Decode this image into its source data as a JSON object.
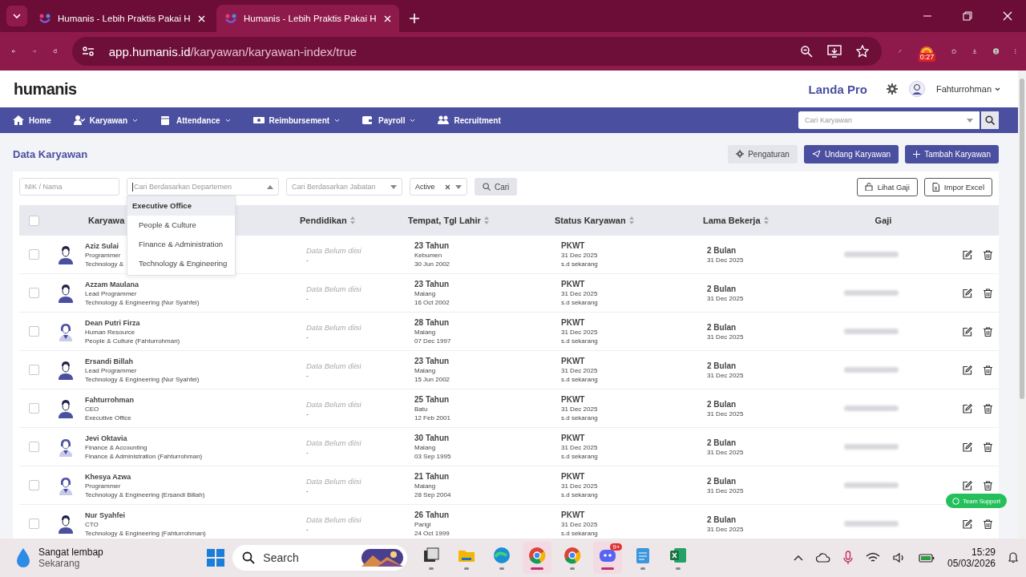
{
  "browser": {
    "tabs": [
      {
        "title": "Humanis - Lebih Praktis Pakai H",
        "selected": false
      },
      {
        "title": "Humanis - Lebih Praktis Pakai H",
        "selected": true
      }
    ],
    "url_host": "app.humanis.id",
    "url_path": "/karyawan/karyawan-index/true",
    "extension_badge": "0:27"
  },
  "header": {
    "logo": "humanis",
    "company": "Landa Pro",
    "user": "Fahturrohman"
  },
  "nav": {
    "items": [
      {
        "label": "Home",
        "caret": false
      },
      {
        "label": "Karyawan",
        "caret": true
      },
      {
        "label": "Attendance",
        "caret": true
      },
      {
        "label": "Reimbursement",
        "caret": true
      },
      {
        "label": "Payroll",
        "caret": true
      },
      {
        "label": "Recruitment",
        "caret": false
      }
    ],
    "search_placeholder": "Cari Karyawan"
  },
  "page": {
    "title": "Data Karyawan",
    "buttons": [
      {
        "label": "Pengaturan",
        "kind": "settings"
      },
      {
        "label": "Undang Karyawan",
        "kind": "invite"
      },
      {
        "label": "Tambah Karyawan",
        "kind": "add"
      }
    ]
  },
  "filters": {
    "name_placeholder": "NIK / Nama",
    "department_placeholder": "Cari Berdasarkan Departemen",
    "position_placeholder": "Cari Berdasarkan Jabatan",
    "status_value": "Active",
    "search_button": "Cari",
    "salary_button": "Lihat Gaji",
    "import_button": "Impor Excel",
    "department_options": [
      {
        "label": "Executive Office",
        "selected": true
      },
      {
        "label": "People & Culture",
        "selected": false
      },
      {
        "label": "Finance & Administration",
        "selected": false
      },
      {
        "label": "Technology & Engineering",
        "selected": false
      }
    ]
  },
  "table": {
    "all_checked": false,
    "columns": [
      {
        "label": "Karyawa",
        "sortable": false
      },
      {
        "label": "Pendidikan",
        "sortable": true
      },
      {
        "label": "Tempat, Tgl Lahir",
        "sortable": true
      },
      {
        "label": "Status Karyawan",
        "sortable": true
      },
      {
        "label": "Lama Bekerja",
        "sortable": true
      },
      {
        "label": "Gaji",
        "sortable": false
      }
    ],
    "rows": [
      {
        "checked": false,
        "kind": "male",
        "name": "Aziz Sulai",
        "position": "Programmer",
        "department": "Technology &",
        "education": "Data Belum diisi",
        "education_detail": "-",
        "age": "23 Tahun",
        "city": "Kebumen",
        "birth_date": "30 Jun 2002",
        "status": "PKWT",
        "status_date": "31 Dec 2025",
        "status_until": "s.d sekarang",
        "tenure": "2 Bulan",
        "tenure_date": "31 Dec 2025",
        "salary_hidden": true
      },
      {
        "checked": false,
        "kind": "male",
        "name": "Azzam Maulana",
        "position": "Lead Programmer",
        "department": "Technology & Engineering (Nur Syahfei)",
        "education": "Data Belum diisi",
        "education_detail": "-",
        "age": "23 Tahun",
        "city": "Malang",
        "birth_date": "16 Oct 2002",
        "status": "PKWT",
        "status_date": "31 Dec 2025",
        "status_until": "s.d sekarang",
        "tenure": "2 Bulan",
        "tenure_date": "31 Dec 2025",
        "salary_hidden": true
      },
      {
        "checked": false,
        "kind": "female",
        "name": "Dean Putri Firza",
        "position": "Human Resource",
        "department": "People & Culture (Fahturrohman)",
        "education": "Data Belum diisi",
        "education_detail": "-",
        "age": "28 Tahun",
        "city": "Malang",
        "birth_date": "07 Dec 1997",
        "status": "PKWT",
        "status_date": "31 Dec 2025",
        "status_until": "s.d sekarang",
        "tenure": "2 Bulan",
        "tenure_date": "31 Dec 2025",
        "salary_hidden": true
      },
      {
        "checked": false,
        "kind": "male",
        "name": "Ersandi Billah",
        "position": "Lead Programmer",
        "department": "Technology & Engineering (Nur Syahfei)",
        "education": "Data Belum diisi",
        "education_detail": "-",
        "age": "23 Tahun",
        "city": "Malang",
        "birth_date": "15 Jun 2002",
        "status": "PKWT",
        "status_date": "31 Dec 2025",
        "status_until": "s.d sekarang",
        "tenure": "2 Bulan",
        "tenure_date": "31 Dec 2025",
        "salary_hidden": true
      },
      {
        "checked": false,
        "kind": "male",
        "name": "Fahturrohman",
        "position": "CEO",
        "department": "Executive Office",
        "education": "Data Belum diisi",
        "education_detail": "-",
        "age": "25 Tahun",
        "city": "Batu",
        "birth_date": "12 Feb 2001",
        "status": "PKWT",
        "status_date": "31 Dec 2025",
        "status_until": "s.d sekarang",
        "tenure": "2 Bulan",
        "tenure_date": "31 Dec 2025",
        "salary_hidden": true
      },
      {
        "checked": false,
        "kind": "female",
        "name": "Jevi Oktavia",
        "position": "Finance & Accounting",
        "department": "Finance & Administration (Fahturrohman)",
        "education": "Data Belum diisi",
        "education_detail": "-",
        "age": "30 Tahun",
        "city": "Malang",
        "birth_date": "03 Sep 1995",
        "status": "PKWT",
        "status_date": "31 Dec 2025",
        "status_until": "s.d sekarang",
        "tenure": "2 Bulan",
        "tenure_date": "31 Dec 2025",
        "salary_hidden": true
      },
      {
        "checked": false,
        "kind": "female",
        "name": "Khesya Azwa",
        "position": "Programmer",
        "department": "Technology & Engineering (Ersandi Billah)",
        "education": "Data Belum diisi",
        "education_detail": "-",
        "age": "21 Tahun",
        "city": "Malang",
        "birth_date": "28 Sep 2004",
        "status": "PKWT",
        "status_date": "31 Dec 2025",
        "status_until": "s.d sekarang",
        "tenure": "2 Bulan",
        "tenure_date": "31 Dec 2025",
        "salary_hidden": true
      },
      {
        "checked": false,
        "kind": "male",
        "name": "Nur Syahfei",
        "position": "CTO",
        "department": "Technology & Engineering (Fahturrohman)",
        "education": "Data Belum diisi",
        "education_detail": "-",
        "age": "26 Tahun",
        "city": "Parigi",
        "birth_date": "24 Oct 1999",
        "status": "PKWT",
        "status_date": "31 Dec 2025",
        "status_until": "s.d sekarang",
        "tenure": "2 Bulan",
        "tenure_date": "31 Dec 2025",
        "salary_hidden": true
      }
    ]
  },
  "support_button": "Team Support",
  "taskbar": {
    "weather_title": "Sangat lembap",
    "weather_subtitle": "Sekarang",
    "search": "Search",
    "apps": [
      {
        "kind": "taskview",
        "active": false
      },
      {
        "kind": "folder",
        "active": false
      },
      {
        "kind": "edge",
        "active": false
      },
      {
        "kind": "chrome",
        "active": true
      },
      {
        "kind": "chrome",
        "active": false
      },
      {
        "kind": "discord",
        "active": true,
        "badge": "9+"
      },
      {
        "kind": "notepad",
        "active": false
      },
      {
        "kind": "excel",
        "active": false
      }
    ],
    "time": "15:29",
    "date": "05/03/2026"
  }
}
